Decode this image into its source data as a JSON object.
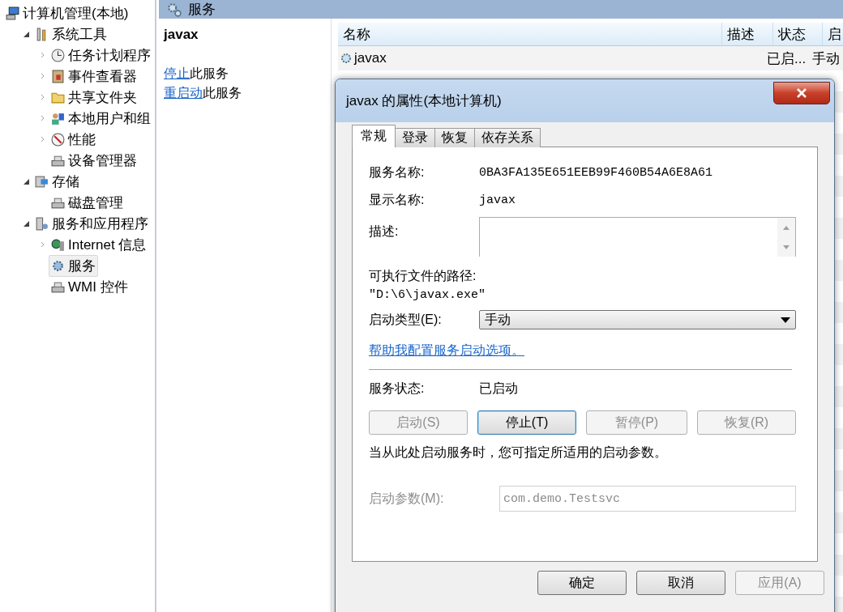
{
  "tree": [
    {
      "label": "计算机管理(本地)",
      "selected": false,
      "children": [
        {
          "label": "系统工具",
          "expanded": true,
          "selected": false,
          "children": [
            {
              "label": "任务计划程序",
              "expanded": false,
              "selected": false
            },
            {
              "label": "事件查看器",
              "expanded": false,
              "selected": false
            },
            {
              "label": "共享文件夹",
              "expanded": false,
              "selected": false
            },
            {
              "label": "本地用户和组",
              "expanded": false,
              "selected": false
            },
            {
              "label": "性能",
              "expanded": false,
              "selected": false
            },
            {
              "label": "设备管理器",
              "selected": false
            }
          ]
        },
        {
          "label": "存储",
          "expanded": true,
          "selected": false,
          "children": [
            {
              "label": "磁盘管理",
              "selected": false
            }
          ]
        },
        {
          "label": "服务和应用程序",
          "expanded": true,
          "selected": false,
          "children": [
            {
              "label": "Internet 信息",
              "expanded": false,
              "selected": false
            },
            {
              "label": "服务",
              "selected": true
            },
            {
              "label": "WMI 控件",
              "selected": false
            }
          ]
        }
      ]
    }
  ],
  "panel_title": "服务",
  "actions": {
    "title": "javax",
    "links": [
      {
        "link": "停止",
        "text": "此服务"
      },
      {
        "link": "重启动",
        "text": "此服务"
      }
    ]
  },
  "services_table": {
    "columns": [
      "名称",
      "描述",
      "状态",
      "启"
    ],
    "rows": [
      {
        "name": "javax",
        "status": "已启...",
        "startup": "手动"
      }
    ]
  },
  "dialog": {
    "title": "javax 的属性(本地计算机)",
    "tabs": [
      {
        "label": "常规",
        "selected": true
      },
      {
        "label": "登录",
        "selected": false
      },
      {
        "label": "恢复",
        "selected": false
      },
      {
        "label": "依存关系",
        "selected": false
      }
    ],
    "service_name": {
      "label": "服务名称:",
      "value": "0BA3FA135E651EEB99F460B54A6E8A61"
    },
    "display_name": {
      "label": "显示名称:",
      "value": "javax"
    },
    "description": {
      "label": "描述:"
    },
    "executable_path": {
      "label": "可执行文件的路径:",
      "value": "\"D:\\6\\javax.exe\""
    },
    "startup_type": {
      "label": "启动类型(E):",
      "value": "手动"
    },
    "help_link": "帮助我配置服务启动选项。",
    "service_status": {
      "label": "服务状态:",
      "value": "已启动"
    },
    "control_buttons": [
      {
        "label": "启动(S)",
        "disabled": true,
        "focused": false
      },
      {
        "label": "停止(T)",
        "disabled": false,
        "focused": true
      },
      {
        "label": "暂停(P)",
        "disabled": true,
        "focused": false
      },
      {
        "label": "恢复(R)",
        "disabled": true,
        "focused": false
      }
    ],
    "hint": "当从此处启动服务时，您可指定所适用的启动参数。",
    "start_parameters": {
      "label": "启动参数(M):",
      "value": "com.demo.Testsvc",
      "disabled": true
    },
    "buttons": [
      {
        "label": "确定",
        "disabled": false
      },
      {
        "label": "取消",
        "disabled": false
      },
      {
        "label": "应用(A)",
        "disabled": true
      }
    ]
  }
}
